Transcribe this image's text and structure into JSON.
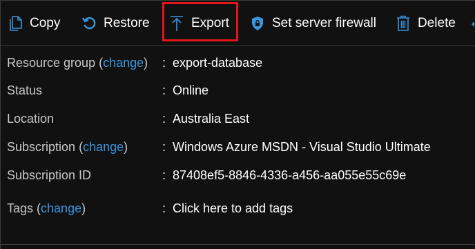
{
  "toolbar": {
    "copy_label": "Copy",
    "restore_label": "Restore",
    "export_label": "Export",
    "firewall_label": "Set server firewall",
    "delete_label": "Delete"
  },
  "colors": {
    "link": "#3a96dd",
    "highlight": "#e3161b",
    "background": "#111111"
  },
  "properties": {
    "resource_group": {
      "label": "Resource group",
      "change": "change",
      "value": "export-database"
    },
    "status": {
      "label": "Status",
      "value": "Online"
    },
    "location": {
      "label": "Location",
      "value": "Australia East"
    },
    "subscription": {
      "label": "Subscription",
      "change": "change",
      "value": "Windows Azure MSDN - Visual Studio Ultimate"
    },
    "subscription_id": {
      "label": "Subscription ID",
      "value": "87408ef5-8846-4336-a456-aa055e55c69e"
    },
    "tags": {
      "label": "Tags",
      "change": "change",
      "value": "Click here to add tags"
    },
    "separator": ":"
  }
}
